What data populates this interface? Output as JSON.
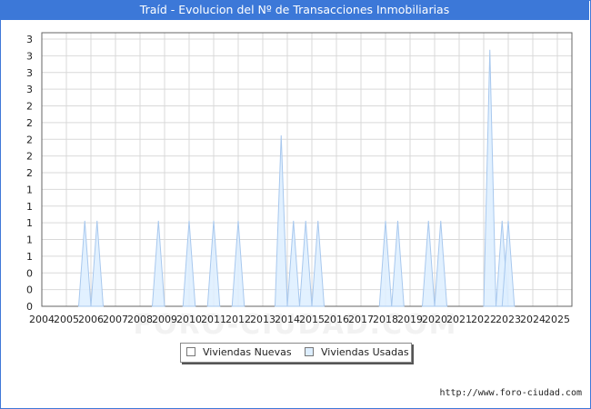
{
  "title": "Traíd - Evolucion del Nº de Transacciones Inmobiliarias",
  "source": "http://www.foro-ciudad.com",
  "watermark": "FORO-CIUDAD.COM",
  "colors": {
    "accent": "#3c78d8",
    "fill": "#ddeeff",
    "stroke": "#a8c8ee"
  },
  "chart_data": {
    "type": "area",
    "title": "Traíd - Evolucion del Nº de Transacciones Inmobiliarias",
    "x_ticks": [
      "2004",
      "2005",
      "2006",
      "2007",
      "2008",
      "2009",
      "2010",
      "2011",
      "2012",
      "2013",
      "2014",
      "2015",
      "2016",
      "2017",
      "2018",
      "2019",
      "2020",
      "2021",
      "2022",
      "2023",
      "2024",
      "2025"
    ],
    "y_ticks": [
      "0",
      "0",
      "0",
      "1",
      "1",
      "1",
      "1",
      "1",
      "2",
      "2",
      "2",
      "2",
      "2",
      "3",
      "3",
      "3",
      "3"
    ],
    "ylim": [
      0,
      3.2
    ],
    "grid": true,
    "legend_position": "bottom",
    "series": [
      {
        "name": "Viviendas Nuevas",
        "color": "#ffffff",
        "points": []
      },
      {
        "name": "Viviendas Usadas",
        "color": "#ddeeff",
        "points": [
          [
            2005.75,
            1
          ],
          [
            2006.25,
            1
          ],
          [
            2008.75,
            1
          ],
          [
            2010.0,
            1
          ],
          [
            2011.0,
            1
          ],
          [
            2012.0,
            1
          ],
          [
            2013.75,
            2
          ],
          [
            2014.25,
            1
          ],
          [
            2014.75,
            1
          ],
          [
            2015.25,
            1
          ],
          [
            2018.0,
            1
          ],
          [
            2018.5,
            1
          ],
          [
            2019.75,
            1
          ],
          [
            2020.25,
            1
          ],
          [
            2022.25,
            3
          ],
          [
            2022.75,
            1
          ],
          [
            2023.0,
            1
          ]
        ]
      }
    ]
  }
}
